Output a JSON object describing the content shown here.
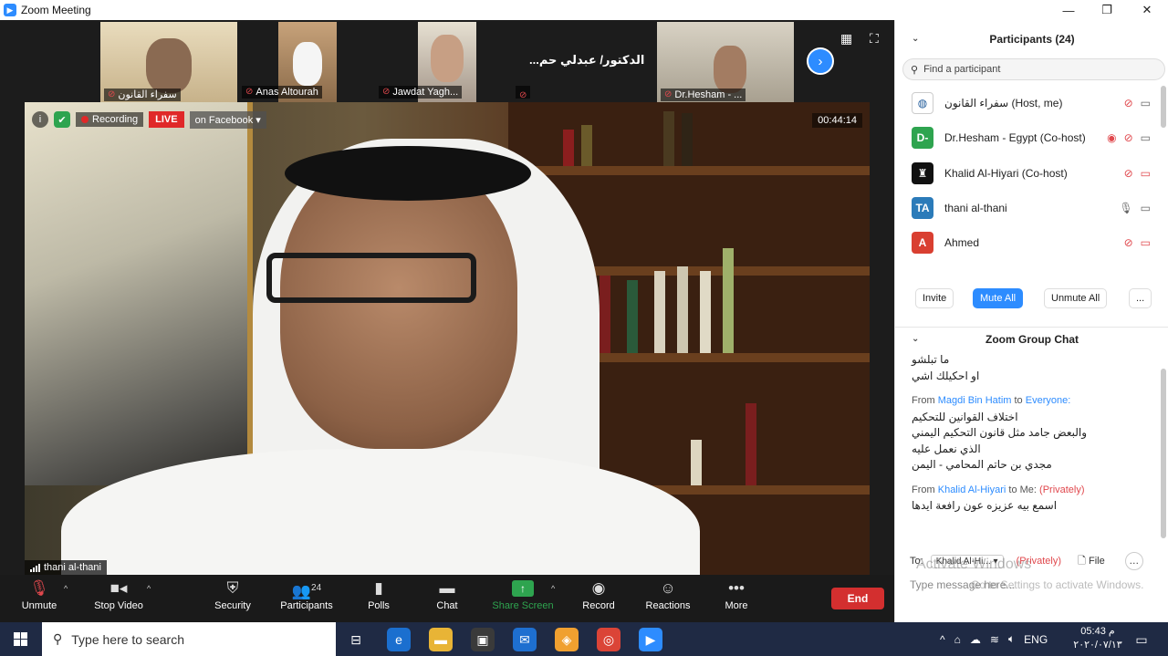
{
  "window": {
    "title": "Zoom Meeting"
  },
  "thumbnails": [
    {
      "name": "سفراء القانون"
    },
    {
      "name": "Anas Altourah"
    },
    {
      "name": "Jawdat Yagh..."
    },
    {
      "name": "...الدكتور/ عبدلي حم"
    },
    {
      "name": "Dr.Hesham - ..."
    }
  ],
  "recording": {
    "label": "Recording",
    "live": "LIVE",
    "platform": "on Facebook",
    "timer": "00:44:14"
  },
  "main_video": {
    "speaker": "thani al-thani"
  },
  "toolbar": {
    "unmute": "Unmute",
    "stop_video": "Stop Video",
    "security": "Security",
    "participants": "Participants",
    "participants_count": "24",
    "polls": "Polls",
    "chat": "Chat",
    "share_screen": "Share Screen",
    "record": "Record",
    "reactions": "Reactions",
    "more": "More",
    "end": "End"
  },
  "participants_panel": {
    "title": "Participants (24)",
    "search_placeholder": "Find a participant",
    "list": [
      {
        "name": "سفراء القانون (Host, me)",
        "avatar": "",
        "avatar_color": "#ffffff"
      },
      {
        "name": "Dr.Hesham - Egypt (Co-host)",
        "avatar": "D-",
        "avatar_color": "#2ea44f"
      },
      {
        "name": "Khalid Al-Hiyari (Co-host)",
        "avatar": "",
        "avatar_color": "#111111"
      },
      {
        "name": "thani al-thani",
        "avatar": "TA",
        "avatar_color": "#2b7bb9"
      },
      {
        "name": "Ahmed",
        "avatar": "A",
        "avatar_color": "#d93f31"
      }
    ],
    "invite": "Invite",
    "mute_all": "Mute All",
    "unmute_all": "Unmute All",
    "more": "..."
  },
  "chat": {
    "title": "Zoom Group Chat",
    "lines": [
      {
        "text": "ما تبلشو"
      },
      {
        "text": "او احكيلك اشي"
      }
    ],
    "msg1_from_prefix": "From",
    "msg1_sender": "Magdi Bin Hatim",
    "msg1_to": "to",
    "msg1_recipient": "Everyone:",
    "msg1_lines": [
      "اختلاف القوانين للتحكيم",
      "والبعض جامد مثل قانون التحكيم اليمني",
      "الذي نعمل عليه",
      "مجدي بن حاتم المحامي - اليمن"
    ],
    "msg2_from_prefix": "From",
    "msg2_sender": "Khalid Al-Hiyari",
    "msg2_to": "to Me:",
    "msg2_private": "(Privately)",
    "msg2_lines": [
      "اسمع بيه عزيزه عون رافعة ايدها"
    ],
    "to_label": "To:",
    "to_value": "Khalid Al-Hi...",
    "to_private": "(Privately)",
    "file_label": "File",
    "input_placeholder": "Type message here..."
  },
  "watermark": {
    "line1": "Activate Windows",
    "line2": "Go to Settings to activate Windows."
  },
  "taskbar": {
    "search_placeholder": "Type here to search",
    "lang": "ENG",
    "time": "05:43 م",
    "date": "٢٠٢٠/٠٧/١٣"
  }
}
